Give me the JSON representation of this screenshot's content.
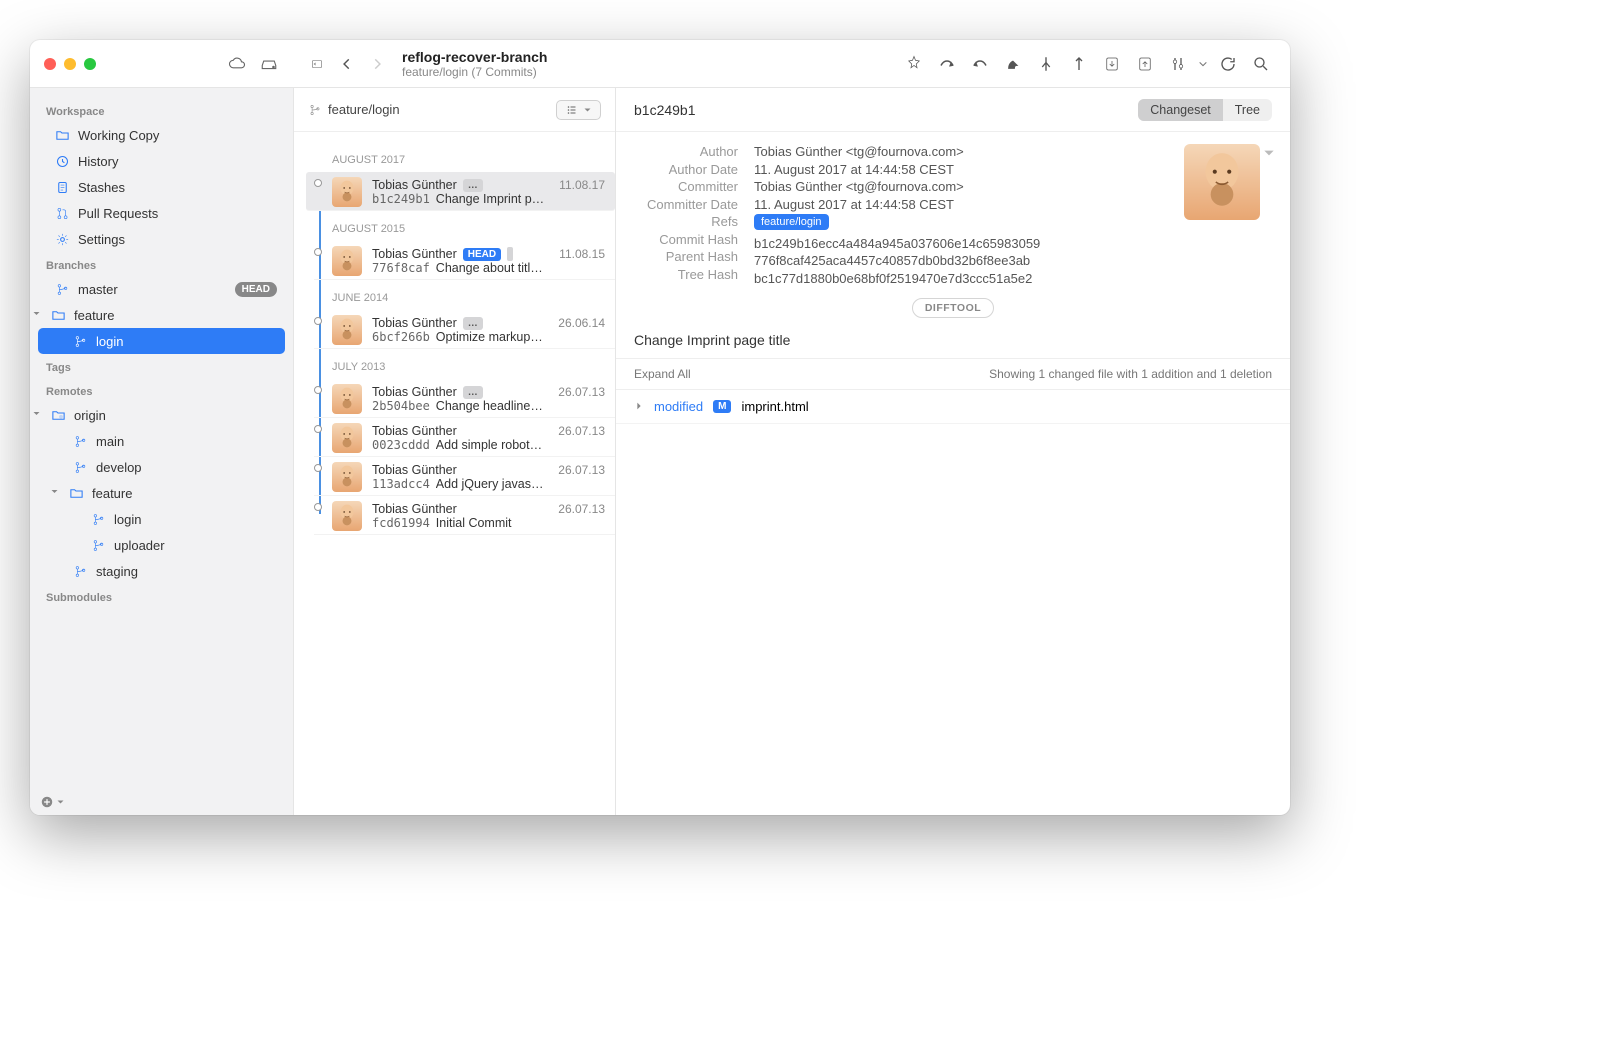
{
  "titlebar": {
    "repo_name": "reflog-recover-branch",
    "repo_sub": "feature/login (7 Commits)"
  },
  "sidebar": {
    "workspace_heading": "Workspace",
    "working_copy": "Working Copy",
    "history": "History",
    "stashes": "Stashes",
    "pull_requests": "Pull Requests",
    "settings": "Settings",
    "branches_heading": "Branches",
    "master": "master",
    "head_badge": "HEAD",
    "feature": "feature",
    "login": "login",
    "tags_heading": "Tags",
    "remotes_heading": "Remotes",
    "origin": "origin",
    "main": "main",
    "develop": "develop",
    "remote_feature": "feature",
    "remote_login": "login",
    "uploader": "uploader",
    "staging": "staging",
    "submodules_heading": "Submodules"
  },
  "history": {
    "branch_filter": "feature/login",
    "groups": [
      {
        "label": "AUGUST 2017",
        "commits": [
          {
            "author": "Tobias Günther",
            "date": "11.08.17",
            "hash": "b1c249b1",
            "msg": "Change Imprint p…",
            "selected": true,
            "chip": "…"
          }
        ]
      },
      {
        "label": "AUGUST 2015",
        "commits": [
          {
            "author": "Tobias Günther",
            "date": "11.08.15",
            "hash": "776f8caf",
            "msg": "Change about titl…",
            "head": true
          }
        ]
      },
      {
        "label": "JUNE 2014",
        "commits": [
          {
            "author": "Tobias Günther",
            "date": "26.06.14",
            "hash": "6bcf266b",
            "msg": "Optimize markup…",
            "chip": "…"
          }
        ]
      },
      {
        "label": "JULY 2013",
        "commits": [
          {
            "author": "Tobias Günther",
            "date": "26.07.13",
            "hash": "2b504bee",
            "msg": "Change headline…",
            "chip": "…"
          },
          {
            "author": "Tobias Günther",
            "date": "26.07.13",
            "hash": "0023cddd",
            "msg": "Add simple robot…"
          },
          {
            "author": "Tobias Günther",
            "date": "26.07.13",
            "hash": "113adcc4",
            "msg": "Add jQuery javas…"
          },
          {
            "author": "Tobias Günther",
            "date": "26.07.13",
            "hash": "fcd61994",
            "msg": "Initial Commit"
          }
        ]
      }
    ]
  },
  "detail": {
    "hash_short": "b1c249b1",
    "seg_changeset": "Changeset",
    "seg_tree": "Tree",
    "author_k": "Author",
    "author_v": "Tobias Günther <tg@fournova.com>",
    "author_date_k": "Author Date",
    "author_date_v": "11. August 2017 at 14:44:58 CEST",
    "committer_k": "Committer",
    "committer_v": "Tobias Günther <tg@fournova.com>",
    "committer_date_k": "Committer Date",
    "committer_date_v": "11. August 2017 at 14:44:58 CEST",
    "refs_k": "Refs",
    "refs_v": "feature/login",
    "commit_hash_k": "Commit Hash",
    "commit_hash_v": "b1c249b16ecc4a484a945a037606e14c65983059",
    "parent_hash_k": "Parent Hash",
    "parent_hash_v": "776f8caf425aca4457c40857db0bd32b6f8ee3ab",
    "tree_hash_k": "Tree Hash",
    "tree_hash_v": "bc1c77d1880b0e68bf0f2519470e7d3ccc51a5e2",
    "difftool": "DIFFTOOL",
    "commit_title": "Change Imprint page title",
    "expand_all": "Expand All",
    "file_stats": "Showing 1 changed file with 1 addition and 1 deletion",
    "file_status": "modified",
    "file_chip": "M",
    "file_name": "imprint.html"
  }
}
